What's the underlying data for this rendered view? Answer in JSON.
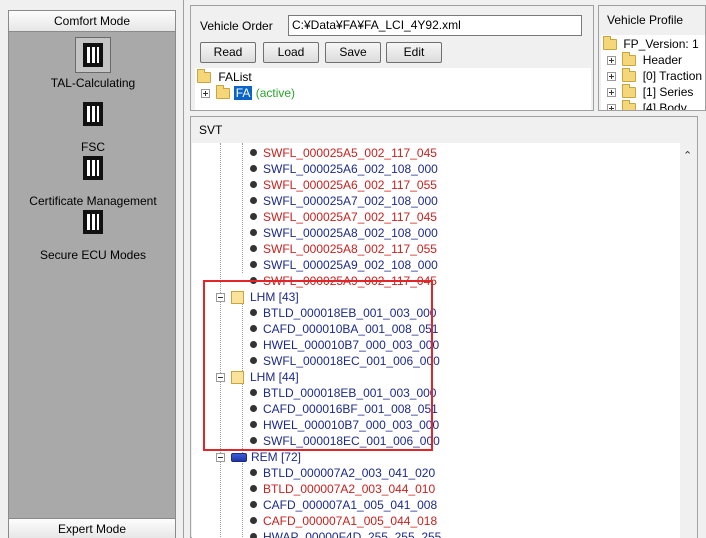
{
  "sidebar": {
    "comfort_mode_label": "Comfort Mode",
    "expert_mode_label": "Expert Mode",
    "tools": [
      {
        "label": "TAL-Calculating",
        "selected": true
      },
      {
        "label": "FSC",
        "selected": false
      },
      {
        "label": "Certificate Management",
        "selected": false
      },
      {
        "label": "Secure ECU Modes",
        "selected": false
      }
    ]
  },
  "vehicle_order": {
    "label": "Vehicle Order",
    "path": "C:¥Data¥FA¥FA_LCI_4Y92.xml",
    "buttons": {
      "read": "Read",
      "load": "Load",
      "save": "Save",
      "edit": "Edit"
    },
    "tree": {
      "root": "FAList",
      "child": "FA",
      "child_status": "(active)"
    }
  },
  "vehicle_profile": {
    "title": "Vehicle Profile",
    "root": "FP_Version: 1",
    "items": [
      "Header",
      "[0] Traction",
      "[1] Series",
      "[4] Body"
    ]
  },
  "svt": {
    "title": "SVT",
    "items": [
      {
        "text": "SWFL_000025A5_002_117_045",
        "color": "red"
      },
      {
        "text": "SWFL_000025A6_002_108_000",
        "color": "blue"
      },
      {
        "text": "SWFL_000025A6_002_117_055",
        "color": "red"
      },
      {
        "text": "SWFL_000025A7_002_108_000",
        "color": "blue"
      },
      {
        "text": "SWFL_000025A7_002_117_045",
        "color": "red"
      },
      {
        "text": "SWFL_000025A8_002_108_000",
        "color": "blue"
      },
      {
        "text": "SWFL_000025A8_002_117_055",
        "color": "red"
      },
      {
        "text": "SWFL_000025A9_002_108_000",
        "color": "blue"
      },
      {
        "text": "SWFL_000025A9_002_117_045",
        "color": "red"
      }
    ],
    "lhm43": {
      "label": "LHM [43]",
      "items": [
        "BTLD_000018EB_001_003_000",
        "CAFD_000010BA_001_008_051",
        "HWEL_000010B7_000_003_000",
        "SWFL_000018EC_001_006_000"
      ]
    },
    "lhm44": {
      "label": "LHM [44]",
      "items": [
        "BTLD_000018EB_001_003_000",
        "CAFD_000016BF_001_008_051",
        "HWEL_000010B7_000_003_000",
        "SWFL_000018EC_001_006_000"
      ]
    },
    "rem": {
      "label": "REM [72]",
      "items": [
        {
          "text": "BTLD_000007A2_003_041_020",
          "color": "blue"
        },
        {
          "text": "BTLD_000007A2_003_044_010",
          "color": "red"
        },
        {
          "text": "CAFD_000007A1_005_041_008",
          "color": "blue"
        },
        {
          "text": "CAFD_000007A1_005_044_018",
          "color": "red"
        },
        {
          "text": "HWAP_00000F4D_255_255_255",
          "color": "blue"
        }
      ]
    }
  },
  "colors": {
    "red_text": "#c8211e",
    "blue_text": "#1c2a8a",
    "highlight": "#e0262b",
    "selection": "#0a64c8"
  }
}
